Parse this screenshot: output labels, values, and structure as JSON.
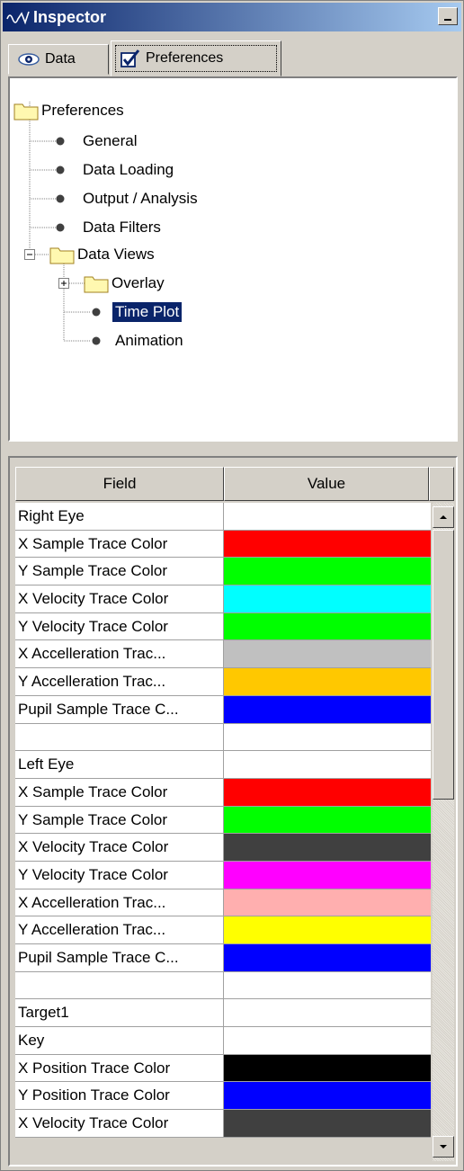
{
  "window": {
    "title": "Inspector",
    "icons": {
      "logo": "waveform-logo-icon",
      "minimize": "minimize-icon"
    }
  },
  "tabs": [
    {
      "label": "Data",
      "icon": "eye-icon"
    },
    {
      "label": "Preferences",
      "icon": "checkbox-icon",
      "selected": true
    }
  ],
  "tree": {
    "root": "Preferences",
    "items": [
      {
        "label": "General"
      },
      {
        "label": "Data Loading"
      },
      {
        "label": "Output / Analysis"
      },
      {
        "label": "Data Filters"
      },
      {
        "label": "Data Views",
        "expanded": true
      },
      {
        "label": "Overlay",
        "collapsed": true
      },
      {
        "label": "Time Plot",
        "selected": true
      },
      {
        "label": "Animation"
      }
    ]
  },
  "table": {
    "headers": {
      "field": "Field",
      "value": "Value"
    },
    "rows": [
      {
        "field": "Right Eye",
        "color": "#ffffff"
      },
      {
        "field": "X Sample Trace Color",
        "color": "#ff0000"
      },
      {
        "field": "Y Sample Trace Color",
        "color": "#00ff00"
      },
      {
        "field": "X Velocity Trace Color",
        "color": "#00ffff"
      },
      {
        "field": "Y Velocity Trace Color",
        "color": "#00ff00"
      },
      {
        "field": "X Accelleration Trac...",
        "color": "#c0c0c0"
      },
      {
        "field": "Y Accelleration Trac...",
        "color": "#ffc800"
      },
      {
        "field": "Pupil Sample Trace C...",
        "color": "#0000ff"
      },
      {
        "field": "",
        "color": "#ffffff"
      },
      {
        "field": "Left Eye",
        "color": "#ffffff"
      },
      {
        "field": "X Sample Trace Color",
        "color": "#ff0000"
      },
      {
        "field": "Y Sample Trace Color",
        "color": "#00ff00"
      },
      {
        "field": "X Velocity Trace Color",
        "color": "#404040"
      },
      {
        "field": "Y Velocity Trace Color",
        "color": "#ff00ff"
      },
      {
        "field": "X Accelleration Trac...",
        "color": "#ffafaf"
      },
      {
        "field": "Y Accelleration Trac...",
        "color": "#ffff00"
      },
      {
        "field": "Pupil Sample Trace C...",
        "color": "#0000ff"
      },
      {
        "field": "",
        "color": "#ffffff"
      },
      {
        "field": "Target1",
        "color": "#ffffff"
      },
      {
        "field": "Key",
        "color": "#ffffff"
      },
      {
        "field": "X Position Trace Color",
        "color": "#000000"
      },
      {
        "field": "Y Position Trace Color",
        "color": "#0000ff"
      },
      {
        "field": "X Velocity Trace Color",
        "color": "#404040"
      }
    ]
  },
  "scrollbar": {
    "up": "scroll-up-arrow-icon",
    "down": "scroll-down-arrow-icon"
  }
}
